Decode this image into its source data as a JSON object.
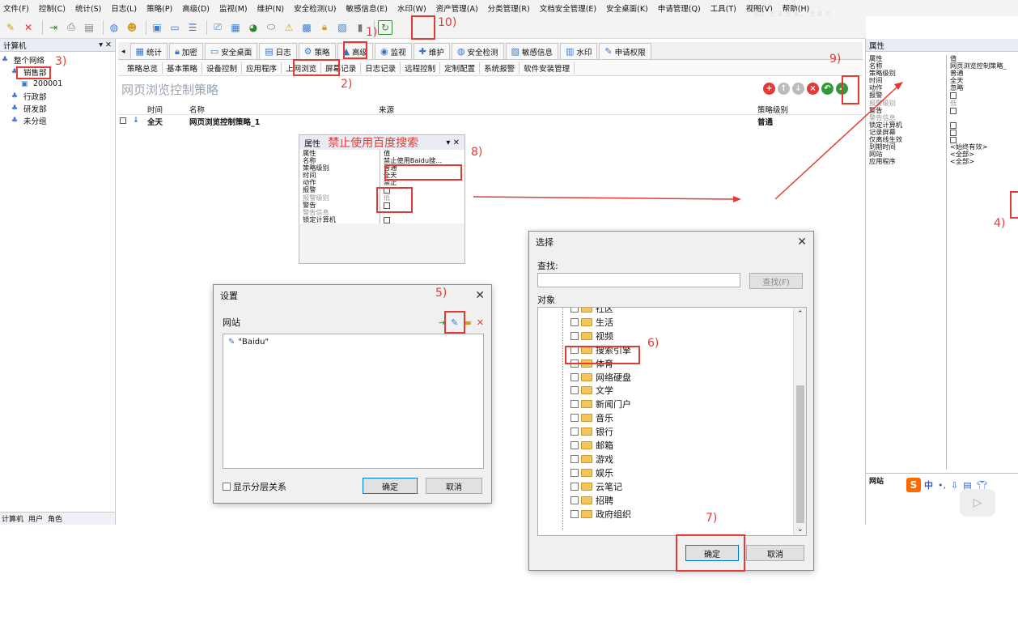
{
  "menu": [
    "文件(F)",
    "控制(C)",
    "统计(S)",
    "日志(L)",
    "策略(P)",
    "高级(D)",
    "监视(M)",
    "维护(N)",
    "安全检测(U)",
    "敏感信息(E)",
    "水印(W)",
    "资产管理(A)",
    "分类管理(R)",
    "文档安全管理(E)",
    "安全桌面(K)",
    "申请管理(Q)",
    "工具(T)",
    "视图(V)",
    "帮助(H)"
  ],
  "watermark": "bilibili",
  "left_panel": {
    "title": "计算机",
    "tree": [
      {
        "label": "整个网络",
        "level": 0
      },
      {
        "label": "销售部",
        "level": 1
      },
      {
        "label": "200001",
        "level": 2
      },
      {
        "label": "行政部",
        "level": 1
      },
      {
        "label": "研发部",
        "level": 1
      },
      {
        "label": "未分组",
        "level": 1
      }
    ],
    "bottom_tabs": [
      "计算机",
      "用户",
      "角色"
    ]
  },
  "main_tabs": [
    "统计",
    "加密",
    "安全桌面",
    "日志",
    "策略",
    "高级",
    "监视",
    "维护",
    "安全检测",
    "敏感信息",
    "水印",
    "申请权限"
  ],
  "sub_tabs": [
    "策略总览",
    "基本策略",
    "设备控制",
    "应用程序",
    "上网浏览",
    "屏幕记录",
    "日志记录",
    "远程控制",
    "定制配置",
    "系统报警",
    "软件安装管理"
  ],
  "content": {
    "heading": "网页浏览控制策略",
    "columns": [
      "时间",
      "名称",
      "来源",
      "策略级别"
    ],
    "row": {
      "time": "全天",
      "name": "网页浏览控制策略_1",
      "source": "",
      "level": "普通"
    }
  },
  "right_panel": {
    "title": "属性",
    "header": [
      "属性",
      "值"
    ],
    "rows": [
      {
        "k": "名称",
        "v": "网页浏览控制策略_"
      },
      {
        "k": "策略级别",
        "v": "普通"
      },
      {
        "k": "时间",
        "v": "全天"
      },
      {
        "k": "动作",
        "v": "忽略"
      },
      {
        "k": "报警",
        "v": "",
        "cb": true
      },
      {
        "k": "报警级别",
        "v": "低",
        "gray": true
      },
      {
        "k": "警告",
        "v": "",
        "cb": true
      },
      {
        "k": "警告信息",
        "v": "",
        "gray": true
      },
      {
        "k": "锁定计算机",
        "v": "",
        "cb": true
      },
      {
        "k": "记录屏幕",
        "v": "",
        "cb": true
      },
      {
        "k": "仅离线生效",
        "v": "",
        "cb": true
      },
      {
        "k": "到期时间",
        "v": "<始终有效>"
      },
      {
        "k": "网站",
        "v": "<全部>"
      },
      {
        "k": "应用程序",
        "v": "<全部>"
      }
    ],
    "footer_label": "网站"
  },
  "popup_props": {
    "title": "属性",
    "annotation": "禁止使用百度搜索",
    "header": [
      "属性",
      "值"
    ],
    "rows": [
      {
        "k": "名称",
        "v": "禁止使用Baidu搜..."
      },
      {
        "k": "策略级别",
        "v": "普通"
      },
      {
        "k": "时间",
        "v": "全天"
      },
      {
        "k": "动作",
        "v": "禁止"
      },
      {
        "k": "报警",
        "v": "",
        "cb": true
      },
      {
        "k": "报警级别",
        "v": "低",
        "gray": true
      },
      {
        "k": "警告",
        "v": "",
        "cb": true
      },
      {
        "k": "警告信息",
        "v": "",
        "gray": true
      },
      {
        "k": "锁定计算机",
        "v": "",
        "cb": true
      }
    ]
  },
  "settings_dialog": {
    "title": "设置",
    "section": "网站",
    "entry": "\"Baidu\"",
    "checkbox_label": "显示分层关系",
    "ok": "确定",
    "cancel": "取消"
  },
  "select_dialog": {
    "title": "选择",
    "search_label": "查找:",
    "search_value": "",
    "search_button": "查找(F)",
    "objects_label": "对象",
    "items": [
      "社区",
      "生活",
      "视频",
      "搜索引擎",
      "体育",
      "网络硬盘",
      "文学",
      "新闻门户",
      "音乐",
      "银行",
      "邮箱",
      "游戏",
      "娱乐",
      "云笔记",
      "招聘",
      "政府组织"
    ],
    "ok": "确定",
    "cancel": "取消"
  },
  "annotations": {
    "a1": "1)",
    "a2": "2)",
    "a3": "3)",
    "a4": "4)",
    "a5": "5)",
    "a6": "6)",
    "a7": "7)",
    "a8": "8)",
    "a9": "9)",
    "a10": "10)"
  },
  "ime": {
    "logo": "S",
    "text": "中"
  }
}
